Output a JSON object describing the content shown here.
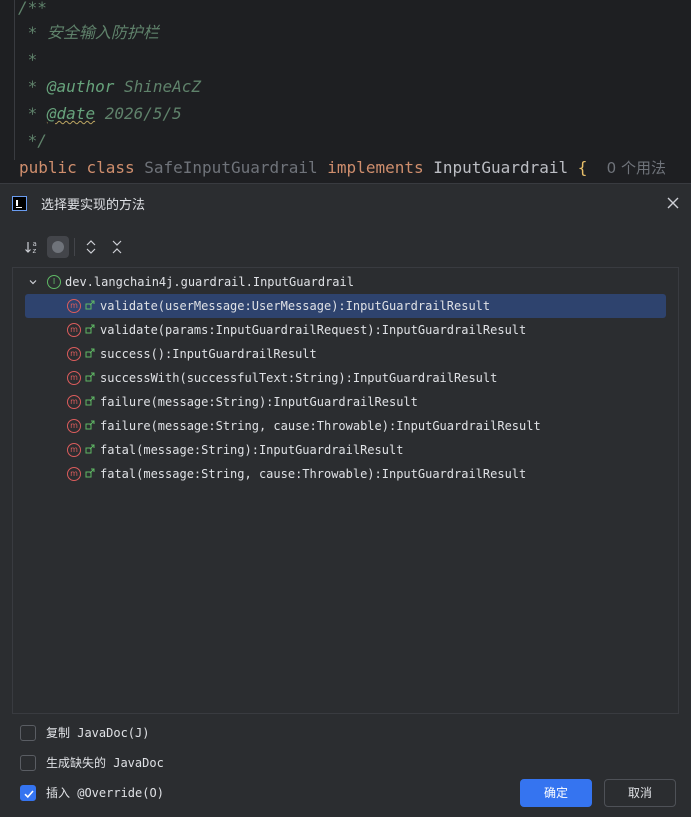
{
  "editor": {
    "line1": "/**",
    "line2_star": " * ",
    "line2_text": "安全输入防护栏",
    "line3": " *",
    "line4_star": " * ",
    "line4_tag": "@author",
    "line4_val": " ShineAcZ",
    "line5_star": " * ",
    "line5_tag": "@date",
    "line5_val": " 2026/5/5",
    "line6": " */",
    "kw_public": "public",
    "kw_class": "class",
    "class_name": "SafeInputGuardrail",
    "kw_implements": "implements",
    "iface_name": "InputGuardrail",
    "brace": "{",
    "usage_hint": "0 个用法"
  },
  "dialog": {
    "title": "选择要实现的方法",
    "tree": {
      "root": "dev.langchain4j.guardrail.InputGuardrail",
      "methods": [
        "validate(userMessage:UserMessage):InputGuardrailResult",
        "validate(params:InputGuardrailRequest):InputGuardrailResult",
        "success():InputGuardrailResult",
        "successWith(successfulText:String):InputGuardrailResult",
        "failure(message:String):InputGuardrailResult",
        "failure(message:String, cause:Throwable):InputGuardrailResult",
        "fatal(message:String):InputGuardrailResult",
        "fatal(message:String, cause:Throwable):InputGuardrailResult"
      ]
    },
    "options": {
      "copy_javadoc": "复制 JavaDoc(J)",
      "gen_missing_javadoc": "生成缺失的 JavaDoc",
      "insert_override": "插入 @Override(O)"
    },
    "buttons": {
      "ok": "确定",
      "cancel": "取消"
    }
  },
  "colors": {
    "accent": "#3574f0",
    "selection": "#2e436e",
    "method_icon": "#db5c5c",
    "interface_icon": "#5fb865"
  }
}
